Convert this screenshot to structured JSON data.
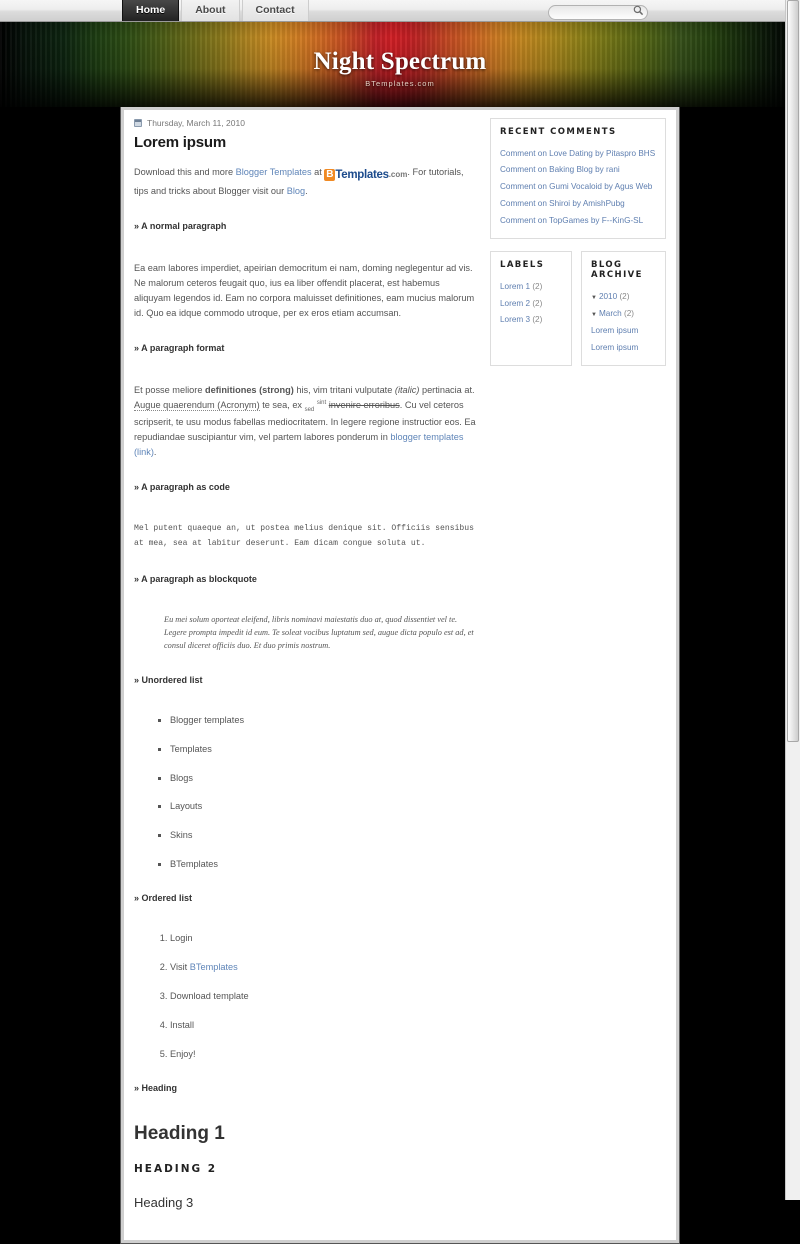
{
  "nav": {
    "items": [
      {
        "label": "Home",
        "active": true
      },
      {
        "label": "About",
        "active": false
      },
      {
        "label": "Contact",
        "active": false
      }
    ]
  },
  "search": {
    "value": "",
    "placeholder": "",
    "icon": "search-icon"
  },
  "banner": {
    "title": "Night Spectrum",
    "subtitle": "BTemplates.com"
  },
  "post": {
    "date": "Thursday, March 11, 2010",
    "date_icon": "calendar-icon",
    "title": "Lorem ipsum",
    "intro": {
      "before_link": "Download this and more ",
      "link1": "Blogger Templates",
      "mid": " at ",
      "logo_b": "B",
      "logo_templates": "Templates",
      "logo_com": ".com",
      "after_logo": ". For tutorials, tips and tricks about Blogger visit our ",
      "link2": "Blog",
      "end": "."
    },
    "sections": {
      "normal_heading": "» A normal paragraph",
      "normal_text": "Ea eam labores imperdiet, apeirian democritum ei nam, doming neglegentur ad vis. Ne malorum ceteros feugait quo, ius ea liber offendit placerat, est habemus aliquyam legendos id. Eam no corpora maluisset definitiones, eam mucius malorum id. Quo ea idque commodo utroque, per ex eros etiam accumsan.",
      "format_heading": "» A paragraph format",
      "format": {
        "t1": "Et posse meliore ",
        "strong": "definitiones (strong)",
        "t2": " his, vim tritani vulputate ",
        "italic": "(italic)",
        "t3": " pertinacia at. ",
        "acronym": "Augue quaerendum (Acronym)",
        "t4": " te sea, ex ",
        "sub": "sed",
        "sup": "sint",
        "strike": "invenire erroribus",
        "t5": ". Cu vel ceteros scripserit, te usu modus fabellas mediocritatem. In legere regione instructior eos. Ea repudiandae suscipiantur vim, vel partem labores ponderum in ",
        "link": "blogger templates (link)",
        "t6": "."
      },
      "code_heading": "» A paragraph as code",
      "code_text": "Mel putent quaeque an, ut postea melius denique sit. Officiis sensibus at mea, sea at labitur deserunt. Eam dicam congue soluta ut.",
      "blockquote_heading": "» A paragraph as blockquote",
      "blockquote_text": "Eu mei solum oporteat eleifend, libris nominavi maiestatis duo at, quod dissentiet vel te. Legere prompta impedit id eum. Te soleat vocibus luptatum sed, augue dicta populo est ad, et consul diceret officiis duo. Et duo primis nostrum.",
      "ul_heading": "» Unordered list",
      "ul_items": [
        "Blogger templates",
        "Templates",
        "Blogs",
        "Layouts",
        "Skins",
        "BTemplates"
      ],
      "ol_heading": "» Ordered list",
      "ol_items": [
        {
          "text": "Login",
          "link": ""
        },
        {
          "text": "Visit ",
          "link": "BTemplates"
        },
        {
          "text": "Download template",
          "link": ""
        },
        {
          "text": "Install",
          "link": ""
        },
        {
          "text": "Enjoy!",
          "link": ""
        }
      ],
      "heading_heading": "» Heading",
      "h1": "Heading 1",
      "h2": "HEADING 2",
      "h3": "Heading 3"
    }
  },
  "sidebar": {
    "recent_comments": {
      "title": "Recent Comments",
      "items": [
        "Comment on Love Dating by Pitaspro BHS",
        "Comment on Baking Blog by rani",
        "Comment on Gumi Vocaloid by Agus Web",
        "Comment on Shiroi by AmishPubg",
        "Comment on TopGames by F--KinG-SL"
      ]
    },
    "labels": {
      "title": "Labels",
      "items": [
        {
          "label": "Lorem 1",
          "count": "(2)"
        },
        {
          "label": "Lorem 2",
          "count": "(2)"
        },
        {
          "label": "Lorem 3",
          "count": "(2)"
        }
      ]
    },
    "archive": {
      "title": "Blog Archive",
      "year": {
        "label": "2010",
        "count": "(2)",
        "toggle": "▼"
      },
      "month": {
        "label": "March",
        "count": "(2)",
        "toggle": "▼"
      },
      "posts": [
        "Lorem ipsum",
        "Lorem ipsum"
      ]
    }
  },
  "colors": {
    "link": "#5f85b8",
    "accent_orange": "#f08a24",
    "logo_blue": "#1c4b8c",
    "background": "#000000"
  }
}
